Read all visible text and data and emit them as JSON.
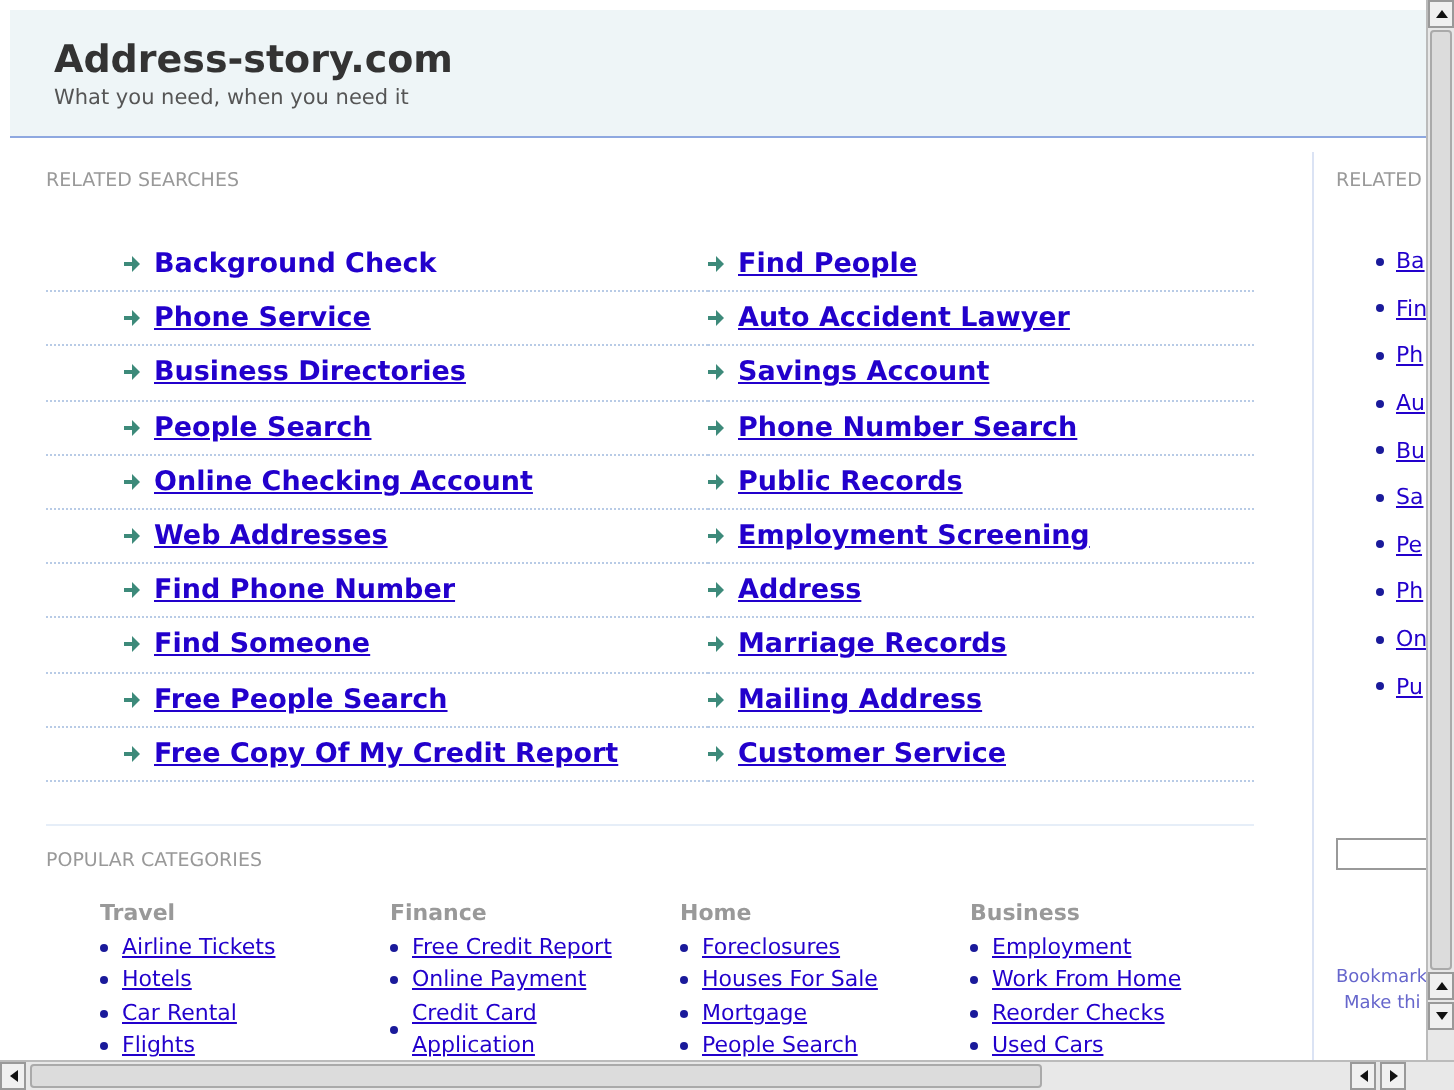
{
  "site": {
    "title": "Address-story.com",
    "tagline": "What you need, when you need it"
  },
  "related_searches": {
    "heading": "RELATED SEARCHES",
    "links": [
      {
        "label": "Background Check",
        "hovered": true
      },
      {
        "label": "Find People",
        "hovered": false
      },
      {
        "label": "Phone Service",
        "hovered": false
      },
      {
        "label": "Auto Accident Lawyer",
        "hovered": false
      },
      {
        "label": "Business Directories",
        "hovered": false
      },
      {
        "label": "Savings Account",
        "hovered": false
      },
      {
        "label": "People Search",
        "hovered": false
      },
      {
        "label": "Phone Number Search",
        "hovered": false
      },
      {
        "label": "Online Checking Account",
        "hovered": false
      },
      {
        "label": "Public Records",
        "hovered": false
      },
      {
        "label": "Web Addresses",
        "hovered": false
      },
      {
        "label": "Employment Screening",
        "hovered": false
      },
      {
        "label": "Find Phone Number",
        "hovered": false
      },
      {
        "label": "Address",
        "hovered": false
      },
      {
        "label": "Find Someone",
        "hovered": false
      },
      {
        "label": "Marriage Records",
        "hovered": false
      },
      {
        "label": "Free People Search",
        "hovered": false
      },
      {
        "label": "Mailing Address",
        "hovered": false
      },
      {
        "label": "Free Copy Of My Credit Report",
        "hovered": false
      },
      {
        "label": "Customer Service",
        "hovered": false
      }
    ]
  },
  "popular_categories": {
    "heading": "POPULAR CATEGORIES",
    "groups": [
      {
        "title": "Travel",
        "links": [
          "Airline Tickets",
          "Hotels",
          "Car Rental",
          "Flights"
        ]
      },
      {
        "title": "Finance",
        "links": [
          "Free Credit Report",
          "Online Payment",
          "Credit Card Application"
        ]
      },
      {
        "title": "Home",
        "links": [
          "Foreclosures",
          "Houses For Sale",
          "Mortgage",
          "People Search"
        ]
      },
      {
        "title": "Business",
        "links": [
          "Employment",
          "Work From Home",
          "Reorder Checks",
          "Used Cars"
        ]
      }
    ]
  },
  "sidebar": {
    "heading": "RELATED",
    "links": [
      "Ba",
      "Fin",
      "Ph",
      "Au",
      "Bu",
      "Sa",
      "Pe",
      "Ph",
      "On",
      "Pu"
    ],
    "footer_links": [
      "Bookmark",
      "Make thi"
    ]
  }
}
